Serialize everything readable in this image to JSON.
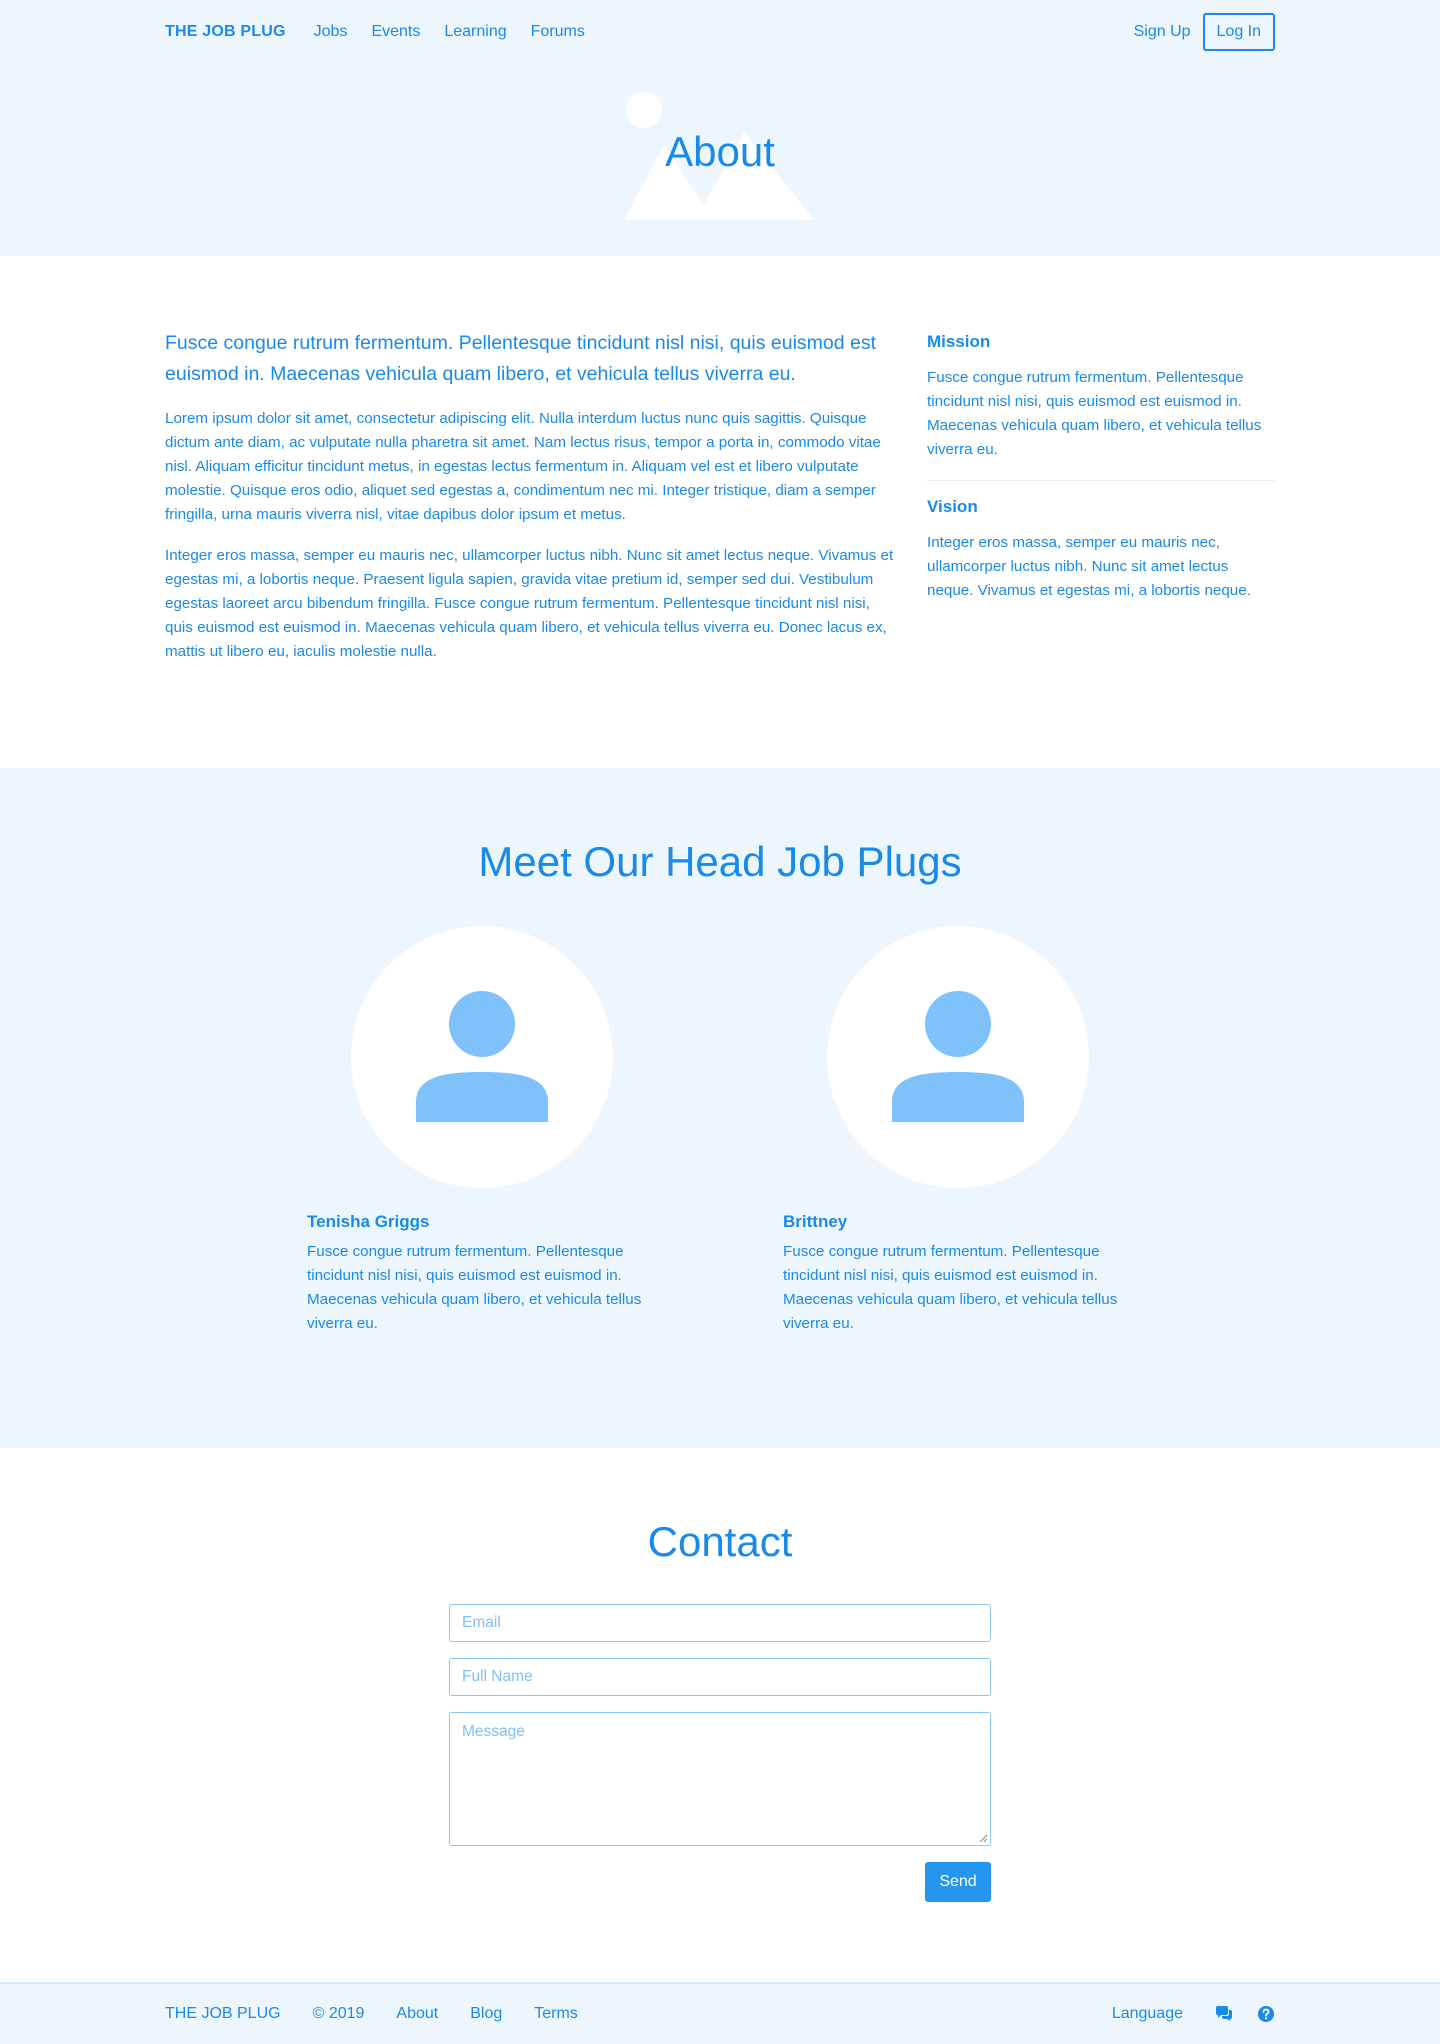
{
  "nav": {
    "brand": "THE JOB PLUG",
    "links": [
      "Jobs",
      "Events",
      "Learning",
      "Forums"
    ],
    "signup": "Sign Up",
    "login": "Log In"
  },
  "hero": {
    "title": "About"
  },
  "about": {
    "lead": "Fusce congue rutrum fermentum. Pellentesque tincidunt nisl nisi, quis euismod est euismod in. Maecenas vehicula quam libero, et vehicula tellus viverra eu.",
    "paragraphs": [
      "Lorem ipsum dolor sit amet, consectetur adipiscing elit. Nulla interdum luctus nunc quis sagittis. Quisque dictum ante diam, ac vulputate nulla pharetra sit amet. Nam lectus risus, tempor a porta in, commodo vitae nisl. Aliquam efficitur tincidunt metus, in egestas lectus fermentum in. Aliquam vel est et libero vulputate molestie. Quisque eros odio, aliquet sed egestas a, condimentum nec mi. Integer tristique, diam a semper fringilla, urna mauris viverra nisl, vitae dapibus dolor ipsum et metus.",
      "Integer eros massa, semper eu mauris nec, ullamcorper luctus nibh. Nunc sit amet lectus neque. Vivamus et egestas mi, a lobortis neque. Praesent ligula sapien, gravida vitae pretium id, semper sed dui. Vestibulum egestas laoreet arcu bibendum fringilla. Fusce congue rutrum fermentum. Pellentesque tincidunt nisl nisi, quis euismod est euismod in. Maecenas vehicula quam libero, et vehicula tellus viverra eu. Donec lacus ex, mattis ut libero eu, iaculis molestie nulla."
    ],
    "mission": {
      "heading": "Mission",
      "text": "Fusce congue rutrum fermentum. Pellentesque tincidunt nisl nisi, quis euismod est euismod in. Maecenas vehicula quam libero, et vehicula tellus viverra eu."
    },
    "vision": {
      "heading": "Vision",
      "text": "Integer eros massa, semper eu mauris nec, ullamcorper luctus nibh. Nunc sit amet lectus neque. Vivamus et egestas mi, a lobortis neque."
    }
  },
  "team": {
    "title": "Meet Our Head Job Plugs",
    "people": [
      {
        "name": "Tenisha Griggs",
        "bio": "Fusce congue rutrum fermentum. Pellentesque tincidunt nisl nisi, quis euismod est euismod in. Maecenas vehicula quam libero, et vehicula tellus viverra eu.",
        "icon": "user-avatar-icon"
      },
      {
        "name": "Brittney",
        "bio": "Fusce congue rutrum fermentum. Pellentesque tincidunt nisl nisi, quis euismod est euismod in. Maecenas vehicula quam libero, et vehicula tellus viverra eu.",
        "icon": "user-avatar-icon"
      }
    ]
  },
  "contact": {
    "title": "Contact",
    "email_placeholder": "Email",
    "name_placeholder": "Full Name",
    "message_placeholder": "Message",
    "send": "Send"
  },
  "footer": {
    "brand": "THE JOB PLUG",
    "copyright": "© 2019",
    "links": [
      "About",
      "Blog",
      "Terms"
    ],
    "language": "Language",
    "icons": [
      "chat-icon",
      "help-icon"
    ]
  },
  "colors": {
    "accent": "#1a8ae8",
    "button": "#2596f0",
    "tint_background": "#eef6fd",
    "avatar_fill": "#7fc2fb",
    "input_border": "#8cc6f5"
  }
}
